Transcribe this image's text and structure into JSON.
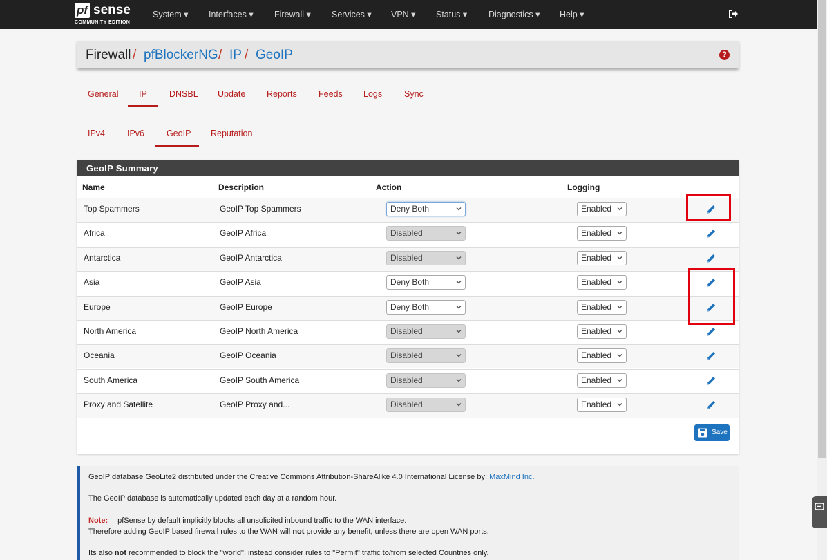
{
  "brand": {
    "pf": "pf",
    "sense": "sense",
    "edition": "COMMUNITY EDITION"
  },
  "nav": {
    "system": "System ▾",
    "interfaces": "Interfaces ▾",
    "firewall": "Firewall ▾",
    "services": "Services ▾",
    "vpn": "VPN ▾",
    "status": "Status ▾",
    "diagnostics": "Diagnostics ▾",
    "help": "Help ▾"
  },
  "breadcrumb": {
    "root": "Firewall",
    "sep": "/",
    "l1": "pfBlockerNG",
    "l2": "IP",
    "l3": "GeoIP",
    "help": "?"
  },
  "tabs": {
    "general": "General",
    "ip": "IP",
    "dnsbl": "DNSBL",
    "update": "Update",
    "reports": "Reports",
    "feeds": "Feeds",
    "logs": "Logs",
    "sync": "Sync"
  },
  "subtabs": {
    "ipv4": "IPv4",
    "ipv6": "IPv6",
    "geoip": "GeoIP",
    "reputation": "Reputation"
  },
  "panel": {
    "title": "GeoIP Summary",
    "columns": {
      "name": "Name",
      "description": "Description",
      "action": "Action",
      "logging": "Logging"
    },
    "rows": [
      {
        "name": "Top Spammers",
        "description": "GeoIP Top Spammers",
        "action": "Deny Both",
        "logging": "Enabled"
      },
      {
        "name": "Africa",
        "description": "GeoIP Africa",
        "action": "Disabled",
        "logging": "Enabled"
      },
      {
        "name": "Antarctica",
        "description": "GeoIP Antarctica",
        "action": "Disabled",
        "logging": "Enabled"
      },
      {
        "name": "Asia",
        "description": "GeoIP Asia",
        "action": "Deny Both",
        "logging": "Enabled"
      },
      {
        "name": "Europe",
        "description": "GeoIP Europe",
        "action": "Deny Both",
        "logging": "Enabled"
      },
      {
        "name": "North America",
        "description": "GeoIP North America",
        "action": "Disabled",
        "logging": "Enabled"
      },
      {
        "name": "Oceania",
        "description": "GeoIP Oceania",
        "action": "Disabled",
        "logging": "Enabled"
      },
      {
        "name": "South America",
        "description": "GeoIP South America",
        "action": "Disabled",
        "logging": "Enabled"
      },
      {
        "name": "Proxy and Satellite",
        "description": "GeoIP Proxy and...",
        "action": "Disabled",
        "logging": "Enabled"
      }
    ],
    "save_label": "Save"
  },
  "info": {
    "line1": "GeoIP database GeoLite2 distributed under the Creative Commons Attribution-ShareAlike 4.0 International License by: ",
    "line1_link": "MaxMind Inc.",
    "line2": "The GeoIP database is automatically updated each day at a random hour.",
    "note_label": "Note:",
    "note_text": "pfSense by default implicitly blocks all unsolicited inbound traffic to the WAN interface.",
    "line4a": "Therefore adding GeoIP based firewall rules to the WAN will ",
    "line4b": "not",
    "line4c": " provide any benefit, unless there are open WAN ports.",
    "line5a": "Its also ",
    "line5b": "not",
    "line5c": " recommended to block the \"world\", instead consider rules to \"Permit\" traffic to/from selected Countries only."
  },
  "colors": {
    "accent": "#b71c1c",
    "link": "#1e73be",
    "navbar": "#212121",
    "highlight": "#e0000f"
  },
  "icons": [
    "logout-icon",
    "help-icon",
    "edit-pencil-icon",
    "save-disk-icon",
    "chevron-down-icon"
  ]
}
